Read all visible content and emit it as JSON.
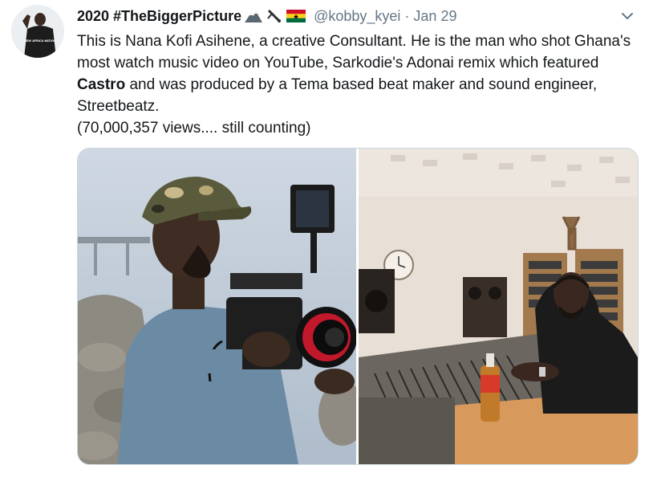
{
  "author": {
    "display_name": "2020 #TheBiggerPicture",
    "name_emojis": [
      "mountain-icon",
      "satellite-dish-icon",
      "ghana-flag-icon"
    ],
    "handle": "@kobby_kyei",
    "separator": "·",
    "date": "Jan 29",
    "avatar_shirt_text": "NEW AFRICA NATION"
  },
  "tweet": {
    "text_before_bold": "This is Nana Kofi Asihene, a creative Consultant. He is the man who shot Ghana's most watch music video on YouTube, Sarkodie's Adonai remix which featured ",
    "bold_text": "Castro",
    "text_after_bold": " and was produced by a Tema based beat maker and sound engineer, Streetbeatz.",
    "views_line": "(70,000,357 views.... still counting)"
  },
  "menu_icon": "chevron-down-icon",
  "media": {
    "left_photo": "man-with-cinema-camera",
    "right_photo": "man-at-studio-mixing-console"
  },
  "colors": {
    "text": "#14171a",
    "secondary": "#657786",
    "border": "#ccd6dd",
    "flag_red": "#ce1126",
    "flag_gold": "#fcd116",
    "flag_green": "#006b3f"
  }
}
